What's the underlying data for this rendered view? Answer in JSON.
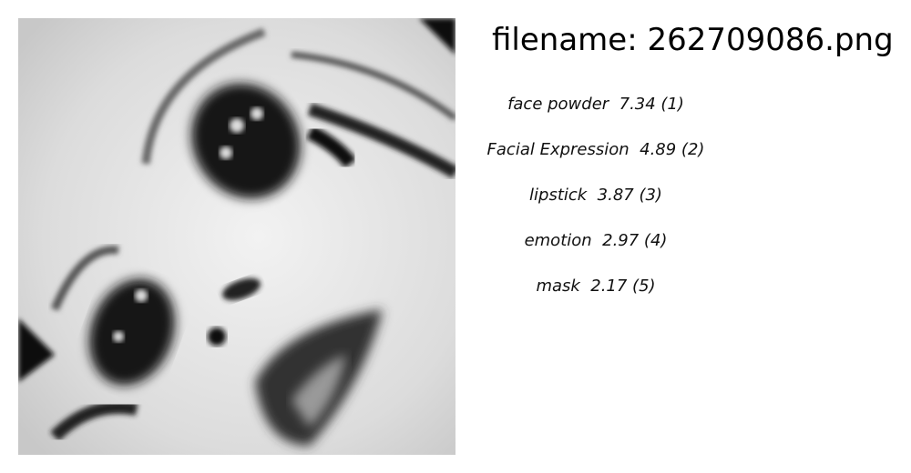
{
  "title": "filename: 262709086.png",
  "image": {
    "description_icon": "grayscale-face-photo"
  },
  "labels": [
    {
      "text": "face powder  7.34 (1)"
    },
    {
      "text": "Facial Expression  4.89 (2)"
    },
    {
      "text": "lipstick  3.87 (3)"
    },
    {
      "text": "emotion  2.97 (4)"
    },
    {
      "text": "mask  2.17 (5)"
    }
  ]
}
